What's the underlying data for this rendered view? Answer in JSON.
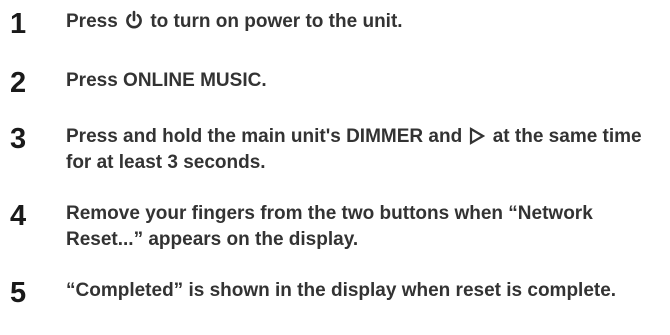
{
  "steps": [
    {
      "number": "1",
      "text_before": "Press ",
      "icon": "power-icon",
      "text_after": " to turn on power to the unit."
    },
    {
      "number": "2",
      "text": "Press ONLINE MUSIC."
    },
    {
      "number": "3",
      "text_before": "Press and hold the main unit's DIMMER and ",
      "icon": "play-triangle-outline-icon",
      "text_after": " at the same time for at least 3 seconds."
    },
    {
      "number": "4",
      "text": "Remove your fingers from the two buttons when “Network Reset...” appears on the display."
    },
    {
      "number": "5",
      "text": "“Completed” is shown in the display when reset is complete."
    }
  ]
}
